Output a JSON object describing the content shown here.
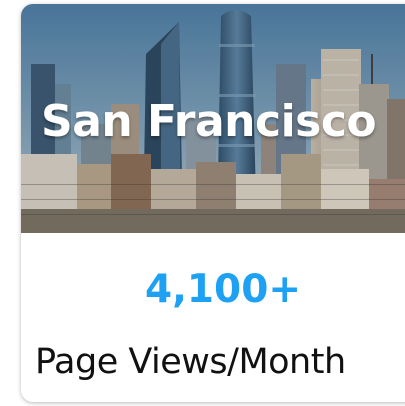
{
  "card": {
    "title": "San Francisco",
    "stat_value": "4,100+",
    "stat_label": "Page Views/Month",
    "image_icon": "city-skyline-photo"
  },
  "colors": {
    "stat": "#1ea1f2",
    "title": "#ffffff",
    "label": "#111111",
    "sky": "#5f86a8"
  }
}
